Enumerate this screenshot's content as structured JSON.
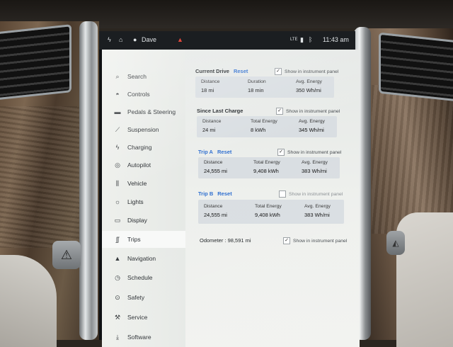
{
  "statusbar": {
    "user": "Dave",
    "signal": "LTE",
    "time": "11:43 am",
    "icons": [
      "bolt-icon",
      "home-icon",
      "user-icon",
      "warning-icon",
      "bluetooth-icon"
    ]
  },
  "sidebar": {
    "items": [
      {
        "label": "Search",
        "icon": "search-icon"
      },
      {
        "label": "Controls",
        "icon": "car-icon"
      },
      {
        "label": "Pedals & Steering",
        "icon": "car-icon"
      },
      {
        "label": "Suspension",
        "icon": "suspension-icon"
      },
      {
        "label": "Charging",
        "icon": "bolt-icon"
      },
      {
        "label": "Autopilot",
        "icon": "steering-wheel-icon"
      },
      {
        "label": "Vehicle",
        "icon": "sliders-icon"
      },
      {
        "label": "Lights",
        "icon": "sun-icon"
      },
      {
        "label": "Display",
        "icon": "display-icon"
      },
      {
        "label": "Trips",
        "icon": "trips-icon"
      },
      {
        "label": "Navigation",
        "icon": "navigation-icon"
      },
      {
        "label": "Schedule",
        "icon": "clock-icon"
      },
      {
        "label": "Safety",
        "icon": "shield-icon"
      },
      {
        "label": "Service",
        "icon": "wrench-icon"
      },
      {
        "label": "Software",
        "icon": "download-icon"
      }
    ],
    "active": "Trips"
  },
  "trips": {
    "show_label": "Show in instrument panel",
    "current_drive": {
      "title": "Current Drive",
      "reset": "Reset",
      "show": true,
      "labels": [
        "Distance",
        "Duration",
        "Avg. Energy"
      ],
      "values": [
        "18 mi",
        "18 min",
        "350 Wh/mi"
      ]
    },
    "since_last_charge": {
      "title": "Since Last Charge",
      "show": true,
      "labels": [
        "Distance",
        "Total Energy",
        "Avg. Energy"
      ],
      "values": [
        "24 mi",
        "8 kWh",
        "345 Wh/mi"
      ]
    },
    "trip_a": {
      "title": "Trip A",
      "reset": "Reset",
      "show": true,
      "labels": [
        "Distance",
        "Total Energy",
        "Avg. Energy"
      ],
      "values": [
        "24,555 mi",
        "9,408 kWh",
        "383 Wh/mi"
      ]
    },
    "trip_b": {
      "title": "Trip B",
      "reset": "Reset",
      "show": false,
      "labels": [
        "Distance",
        "Total Energy",
        "Avg. Energy"
      ],
      "values": [
        "24,555 mi",
        "9,408 kWh",
        "383 Wh/mi"
      ]
    },
    "odometer": "Odometer : 98,591 mi",
    "odometer_show": true
  }
}
